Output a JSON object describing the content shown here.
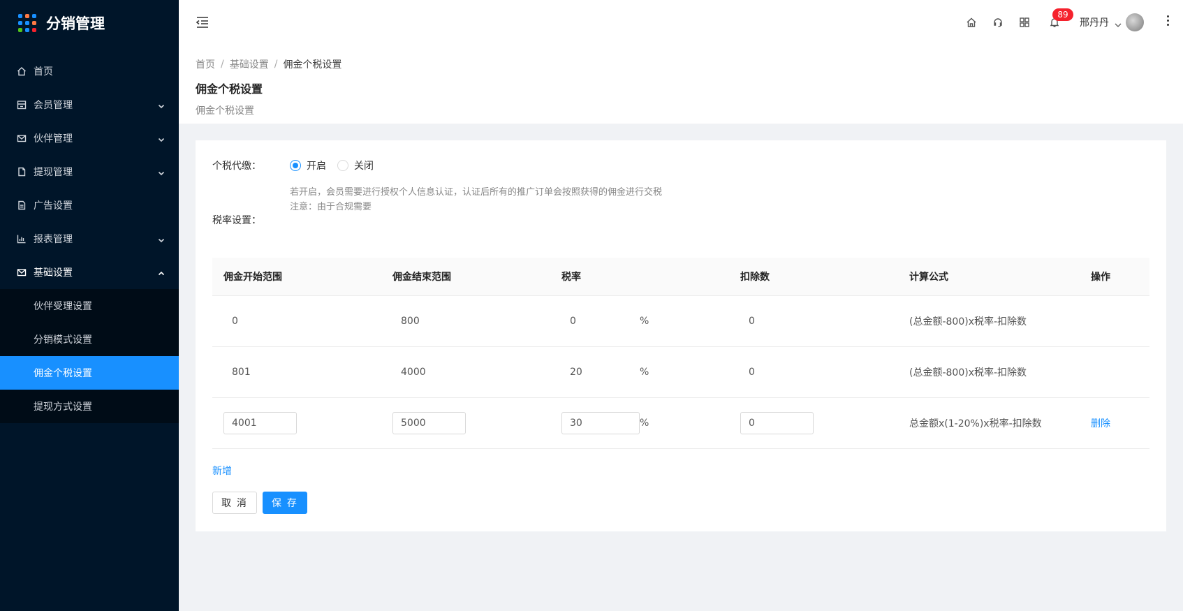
{
  "app": {
    "title": "分销管理"
  },
  "sidebar": {
    "items": [
      {
        "label": "首页"
      },
      {
        "label": "会员管理"
      },
      {
        "label": "伙伴管理"
      },
      {
        "label": "提现管理"
      },
      {
        "label": "广告设置"
      },
      {
        "label": "报表管理"
      },
      {
        "label": "基础设置"
      }
    ],
    "sub_items": [
      {
        "label": "伙伴受理设置"
      },
      {
        "label": "分销模式设置"
      },
      {
        "label": "佣金个税设置"
      },
      {
        "label": "提现方式设置"
      }
    ]
  },
  "header": {
    "notification_count": "89",
    "user_name": "邢丹丹"
  },
  "breadcrumb": {
    "home": "首页",
    "parent": "基础设置",
    "current": "佣金个税设置"
  },
  "page": {
    "title": "佣金个税设置",
    "description": "佣金个税设置"
  },
  "form": {
    "tax_label": "个税代缴：",
    "option_on": "开启",
    "option_off": "关闭",
    "hint_line1": "若开启，会员需要进行授权个人信息认证，认证后所有的推广订单会按照获得的佣金进行交税",
    "hint_line2": "注意：由于合规需要",
    "rate_label": "税率设置："
  },
  "table": {
    "headers": [
      "佣金开始范围",
      "佣金结束范围",
      "税率",
      "扣除数",
      "计算公式",
      "操作"
    ],
    "percent": "%",
    "rows": [
      {
        "start": "0",
        "end": "800",
        "rate": "0",
        "deduction": "0",
        "formula": "(总金额-800)x税率-扣除数"
      },
      {
        "start": "801",
        "end": "4000",
        "rate": "20",
        "deduction": "0",
        "formula": "(总金额-800)x税率-扣除数"
      }
    ],
    "edit_row": {
      "start": "4001",
      "end": "5000",
      "rate": "30",
      "deduction": "0",
      "formula": "总金额x(1-20%)x税率-扣除数",
      "action": "删除"
    }
  },
  "actions": {
    "add": "新增",
    "cancel": "取 消",
    "save": "保 存"
  }
}
